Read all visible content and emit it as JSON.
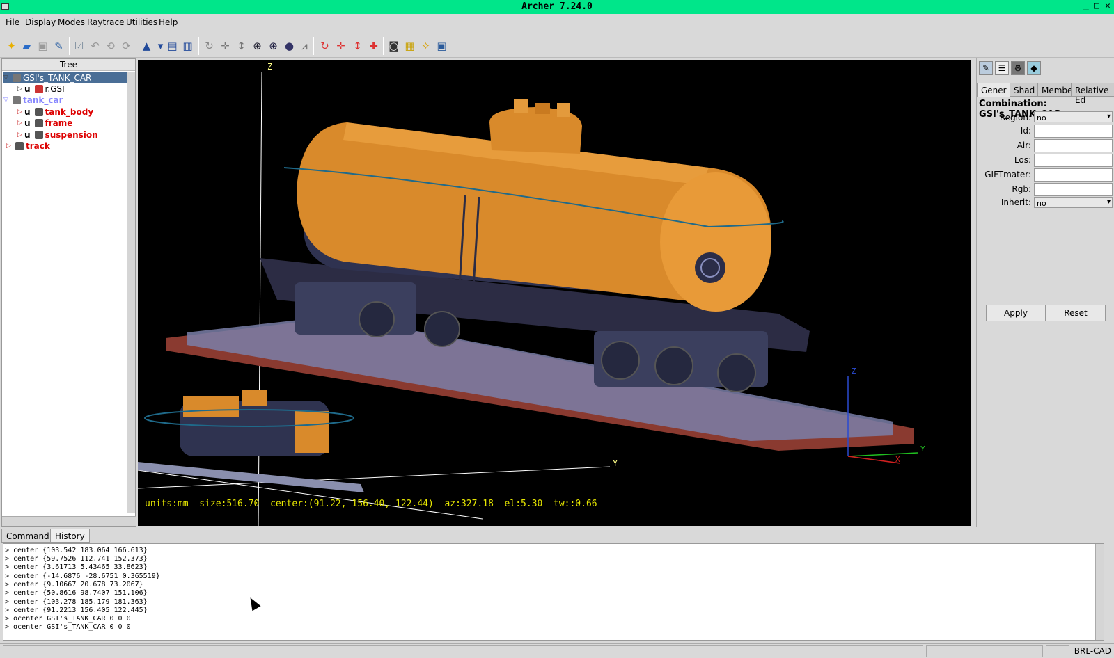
{
  "window": {
    "title": "Archer 7.24.0"
  },
  "menu": [
    "File",
    "Display",
    "Modes",
    "Raytrace",
    "Utilities",
    "Help"
  ],
  "tree": {
    "header": "Tree",
    "nodes": [
      {
        "flag": "",
        "label": "GSI's_TANK_CAR",
        "color": "#000000"
      },
      {
        "flag": "u",
        "label": "r.GSI",
        "color": "#000000"
      },
      {
        "flag": "",
        "label": "tank_car",
        "color": "#8888ff"
      },
      {
        "flag": "u",
        "label": "tank_body",
        "color": "#dd0000"
      },
      {
        "flag": "u",
        "label": "frame",
        "color": "#dd0000"
      },
      {
        "flag": "u",
        "label": "suspension",
        "color": "#dd0000"
      },
      {
        "flag": "",
        "label": "track",
        "color": "#dd0000"
      }
    ]
  },
  "viewport": {
    "axis_z": "Z",
    "axis_y": "Y",
    "small_axis_z": "Z",
    "small_axis_y": "Y",
    "small_axis_x": "X",
    "status": "units:mm  size:516.70  center:(91.22, 156.40, 122.44)  az:327.18  el:5.30  tw::0.66"
  },
  "right_panel": {
    "tabs": [
      "Gener",
      "Shad",
      "Membe",
      "Relative Ed"
    ],
    "combination_title": "Combination: GSI's_TANK_CAR",
    "fields": {
      "region_label": "Region:",
      "region_value": "no",
      "id_label": "Id:",
      "id_value": "",
      "air_label": "Air:",
      "air_value": "",
      "los_label": "Los:",
      "los_value": "",
      "giftmater_label": "GIFTmater:",
      "giftmater_value": "",
      "rgb_label": "Rgb:",
      "rgb_value": "",
      "inherit_label": "Inherit:",
      "inherit_value": "no"
    },
    "apply": "Apply",
    "reset": "Reset"
  },
  "console": {
    "tabs": [
      "Command",
      "History"
    ],
    "lines": [
      "> center {103.542 183.064 166.613}",
      "> center {59.7526 112.741 152.373}",
      "> center {3.61713 5.43465 33.8623}",
      "> center {-14.6876 -28.6751 0.365519}",
      "> center {9.10667 20.678 73.2067}",
      "> center {50.8616 98.7407 151.106}",
      "> center {103.278 185.179 181.363}",
      "> center {91.2213 156.405 122.445}",
      "> ocenter GSI's_TANK_CAR 0 0 0",
      "> ocenter GSI's_TANK_CAR 0 0 0"
    ]
  },
  "statusbar": {
    "brand": "BRL-CAD"
  }
}
